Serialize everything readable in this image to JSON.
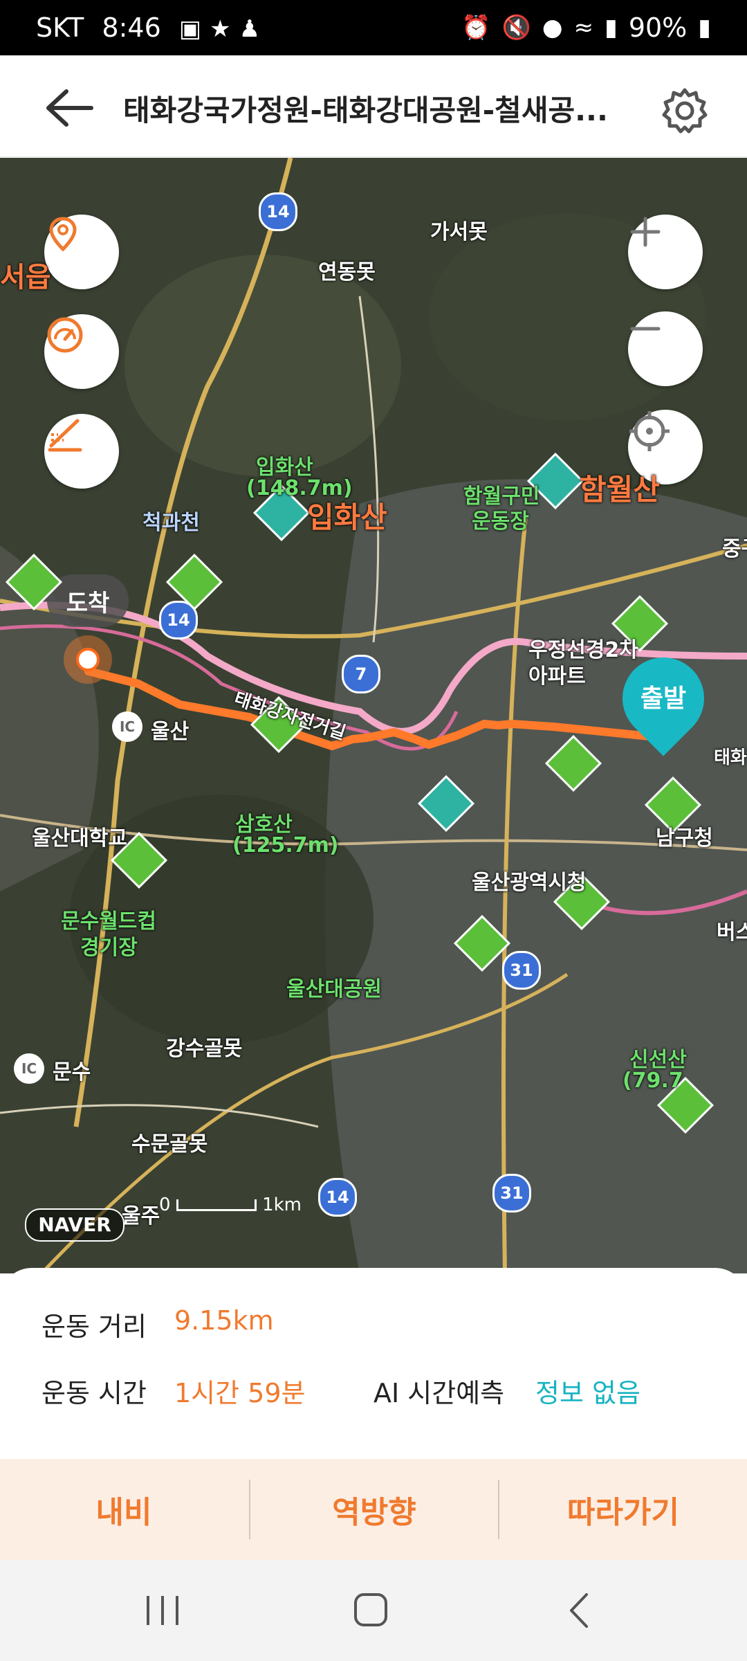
{
  "status_bar": {
    "carrier": "SKT",
    "time": "8:46",
    "battery": "90%"
  },
  "header": {
    "title": "태화강국가정원-태화강대공원-철새공...",
    "back_icon": "arrow-left-icon",
    "settings_icon": "gear-icon"
  },
  "map": {
    "labels": {
      "gaseomot": "가서못",
      "yeondongmot": "연동못",
      "iphwasan_small": "입화산",
      "iphwasan_elev": "(148.7m)",
      "iphwasan_big": "입화산",
      "cheokgwacheon": "척과천",
      "hamwol_gym_1": "함월구민",
      "hamwol_gym_2": "운동장",
      "hamwolsan": "함월산",
      "jung": "중구",
      "ujeong_apt_1": "우정선경2차",
      "ujeong_apt_2": "아파트",
      "ulsan_ic": "울산",
      "ulsan_univ": "울산대학교",
      "samhosan": "삼호산",
      "samhosan_elev": "(125.7m)",
      "city_hall": "울산광역시청",
      "namgu_office": "남구청",
      "munsu_stadium_1": "문수월드컵",
      "munsu_stadium_2": "경기장",
      "ulsan_park": "울산대공원",
      "gangsu": "강수골못",
      "munsu_ic": "문수",
      "sinseonsan": "신선산",
      "sinseonsan_elev": "(79.7",
      "sumun": "수문골못",
      "ulju": "울주",
      "bike_path": "태화강자전거길",
      "taehwa_right": "태화",
      "seoeup": "서읍",
      "bus": "버스"
    },
    "markers": {
      "arrival": "도착",
      "departure": "출발"
    },
    "road_badges": [
      "14",
      "14",
      "7",
      "31",
      "31",
      "14"
    ],
    "ic_badge": "IC",
    "naver_logo": "NAVER",
    "scale_start": "0",
    "scale_end": "1km",
    "controls": {
      "left": [
        "location-pin-icon",
        "speedometer-icon",
        "elevation-icon"
      ],
      "right": [
        "zoom-in-icon",
        "zoom-out-icon",
        "crosshair-icon"
      ]
    }
  },
  "info": {
    "distance_label": "운동 거리",
    "distance_value": "9.15km",
    "time_label": "운동 시간",
    "time_value": "1시간 59분",
    "ai_label": "AI 시간예측",
    "ai_value": "정보 없음"
  },
  "actions": {
    "navi": "내비",
    "reverse": "역방향",
    "follow": "따라가기"
  },
  "colors": {
    "accent": "#f07a2e",
    "teal": "#17b3c1",
    "route": "#ff7a2a"
  }
}
